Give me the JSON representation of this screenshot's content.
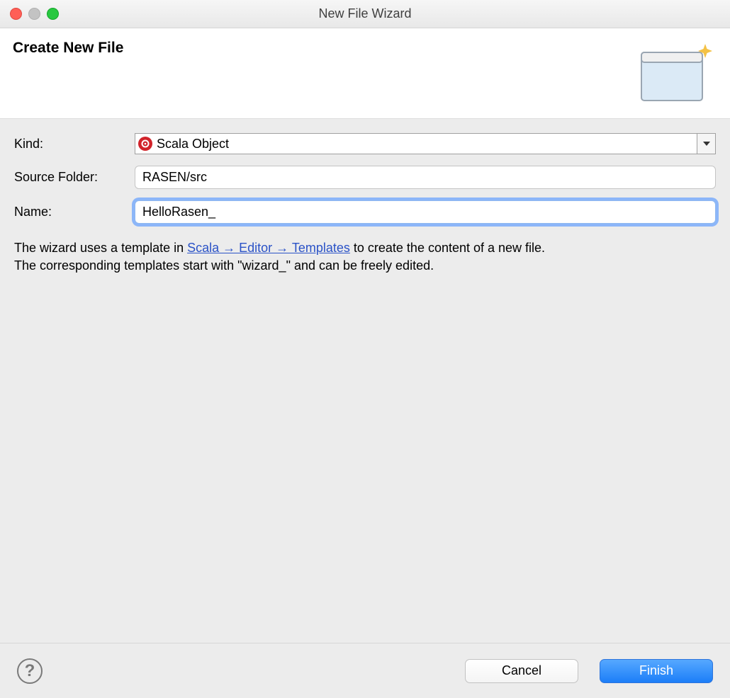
{
  "window": {
    "title": "New File Wizard"
  },
  "header": {
    "title": "Create New File"
  },
  "form": {
    "kind": {
      "label": "Kind:",
      "value": "Scala Object"
    },
    "source_folder": {
      "label": "Source Folder:",
      "value": "RASEN/src"
    },
    "name": {
      "label": "Name:",
      "value": "HelloRasen_"
    }
  },
  "description": {
    "pre": "The wizard uses a template in ",
    "link": "Scala → Editor → Templates",
    "post1": " to create the content of a new file.",
    "line2": "The corresponding templates start with \"wizard_\" and can be freely edited."
  },
  "footer": {
    "cancel": "Cancel",
    "finish": "Finish"
  }
}
